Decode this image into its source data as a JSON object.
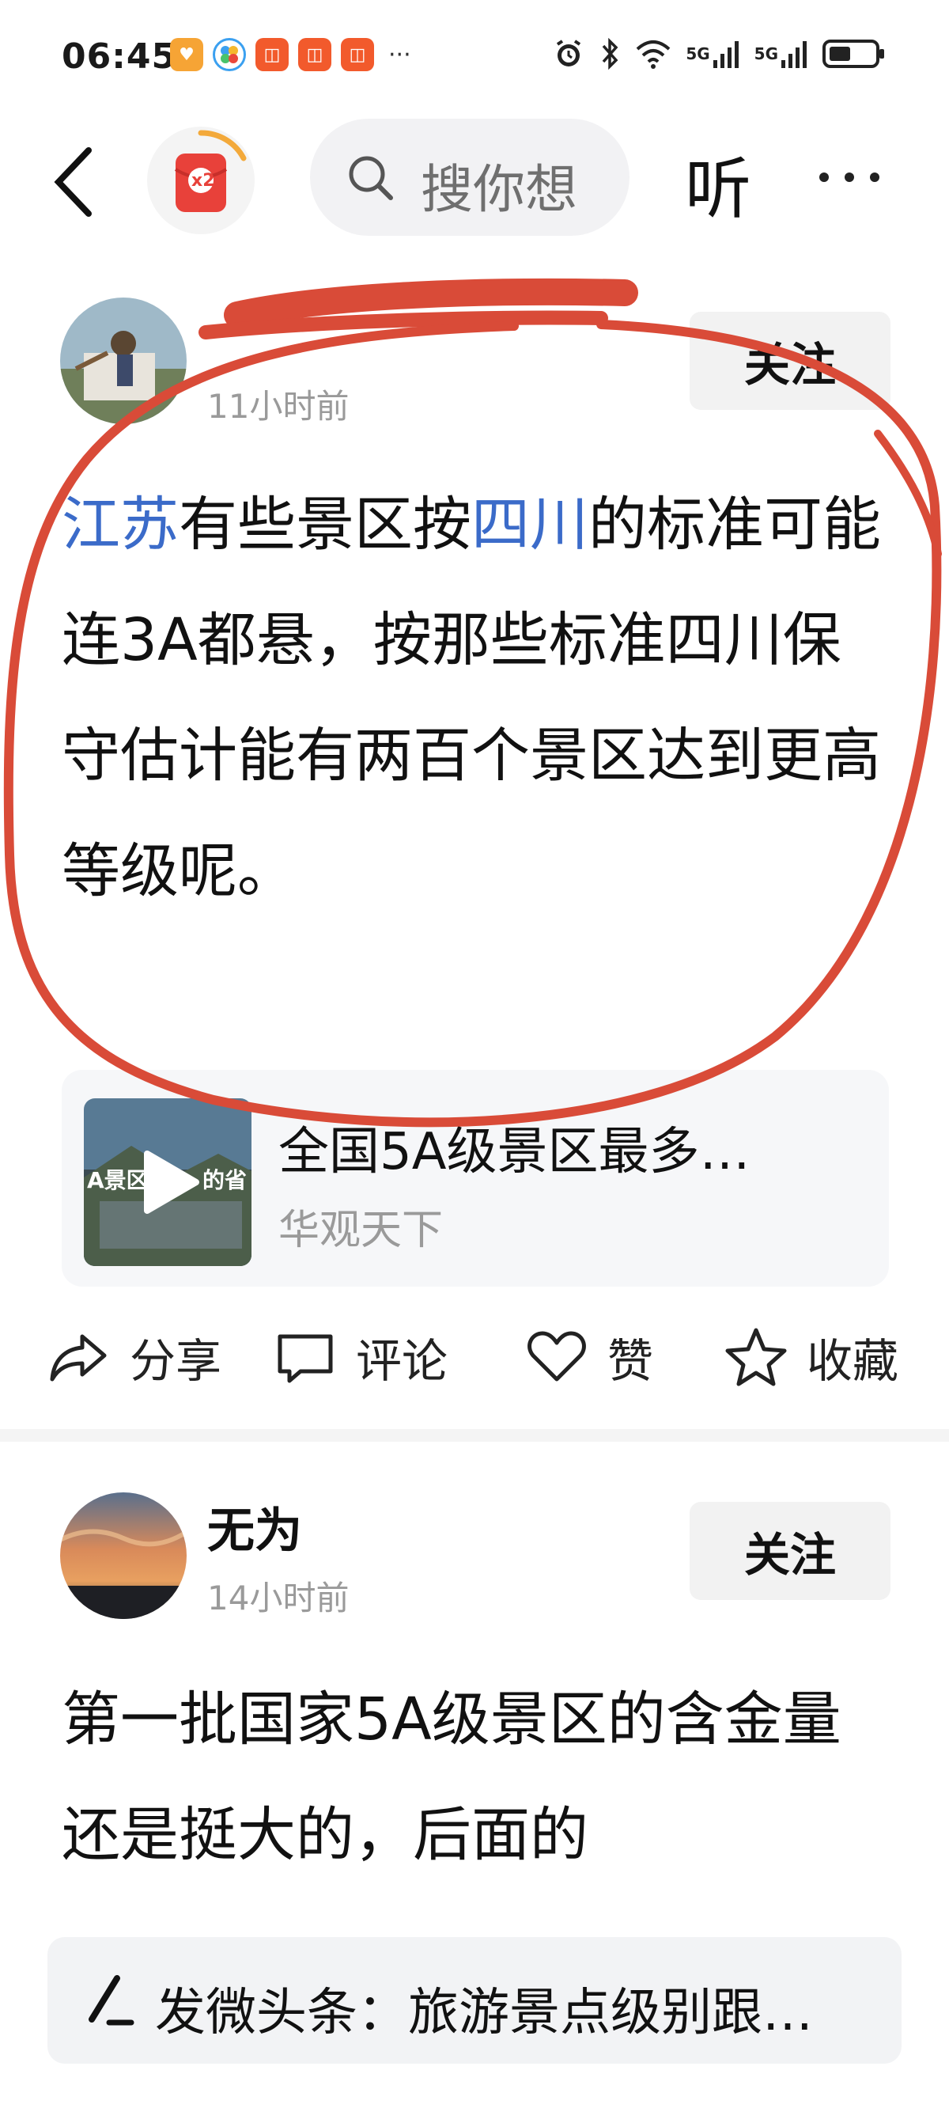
{
  "status_bar": {
    "time": "06:45",
    "network_5g_1": "5G",
    "network_5g_2": "5G",
    "notification_more": "···"
  },
  "nav": {
    "badge_text": "x2",
    "search_placeholder": "搜你想",
    "listen_label": "听"
  },
  "posts": [
    {
      "author": "",
      "time": "11小时前",
      "follow_label": "关注",
      "body_seg1": "江苏",
      "body_seg2": "有些景区按",
      "body_seg3": "四川",
      "body_seg4": "的标准可能连3A都悬，按那些标准四川保守估计能有两百个景区达到更高等级呢。",
      "video": {
        "title": "全国5A级景区最多…",
        "source": "华观天下",
        "thumb_text_left": "A景区",
        "thumb_text_right": "的省"
      },
      "actions": {
        "share": "分享",
        "comment": "评论",
        "like": "赞",
        "collect": "收藏"
      }
    },
    {
      "author": "无为",
      "time": "14小时前",
      "follow_label": "关注",
      "body": "第一批国家5A级景区的含金量还是挺大的，后面的"
    }
  ],
  "compose": {
    "text": "发微头条：旅游景点级别跟…"
  },
  "colors": {
    "accent_blue": "#3b6bc9",
    "annotation_red": "#d94b38",
    "muted_gray": "#9a9a9a"
  }
}
